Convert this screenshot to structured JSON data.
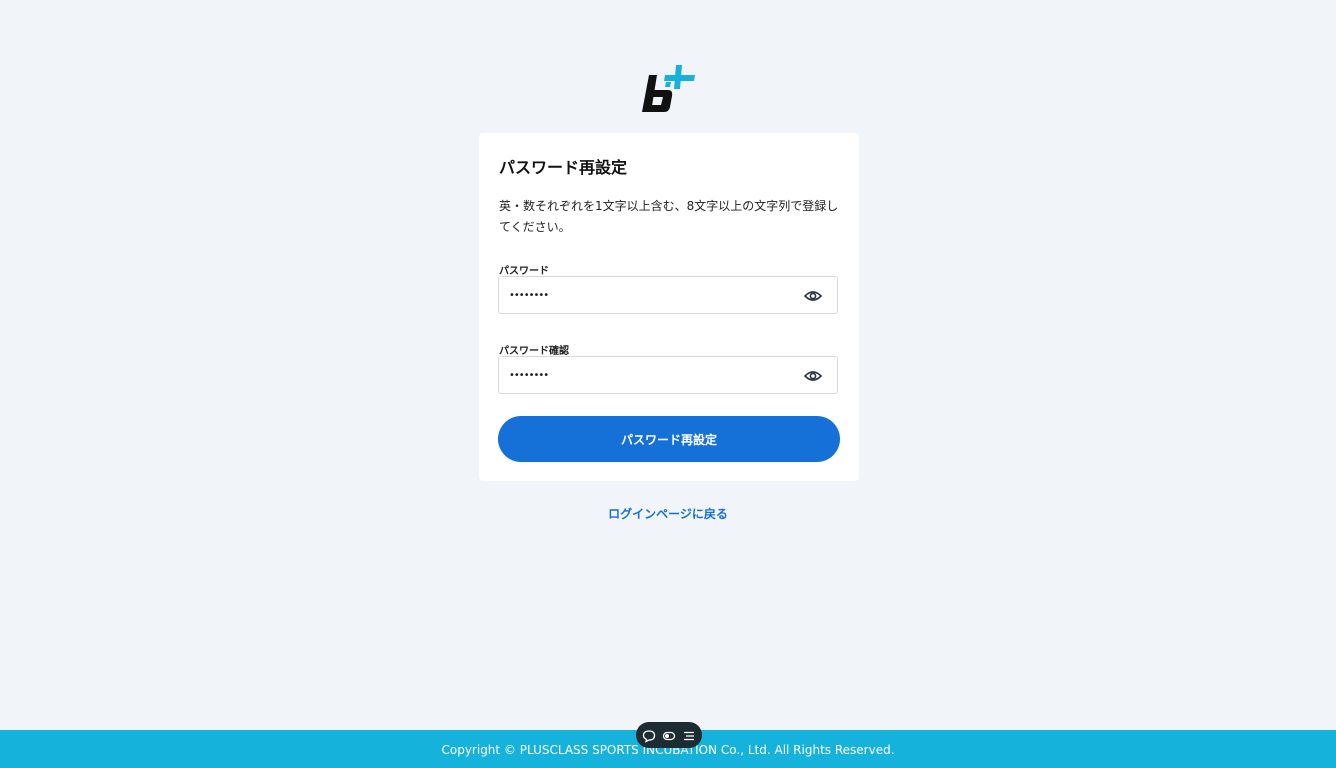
{
  "brand": {
    "logo_icon": "b-plus-logo-icon",
    "accent_color": "#15b3dc"
  },
  "card": {
    "title": "パスワード再設定",
    "description": "英・数それぞれを1文字以上含む、8文字以上の文字列で登録してください。"
  },
  "fields": {
    "password": {
      "label": "パスワード",
      "value": "••••••••",
      "toggle_icon": "eye-icon"
    },
    "password_confirm": {
      "label": "パスワード確認",
      "value": "••••••••",
      "toggle_icon": "eye-icon"
    }
  },
  "submit": {
    "label": "パスワード再設定",
    "color": "#1570d8"
  },
  "back_link": {
    "label": "ログインページに戻る"
  },
  "toolbar": {
    "icons": [
      "comment-icon",
      "toggle-icon",
      "menu-icon"
    ]
  },
  "footer": {
    "copyright": "Copyright © PLUSCLASS SPORTS INCUBATION Co., Ltd. All Rights Reserved."
  }
}
